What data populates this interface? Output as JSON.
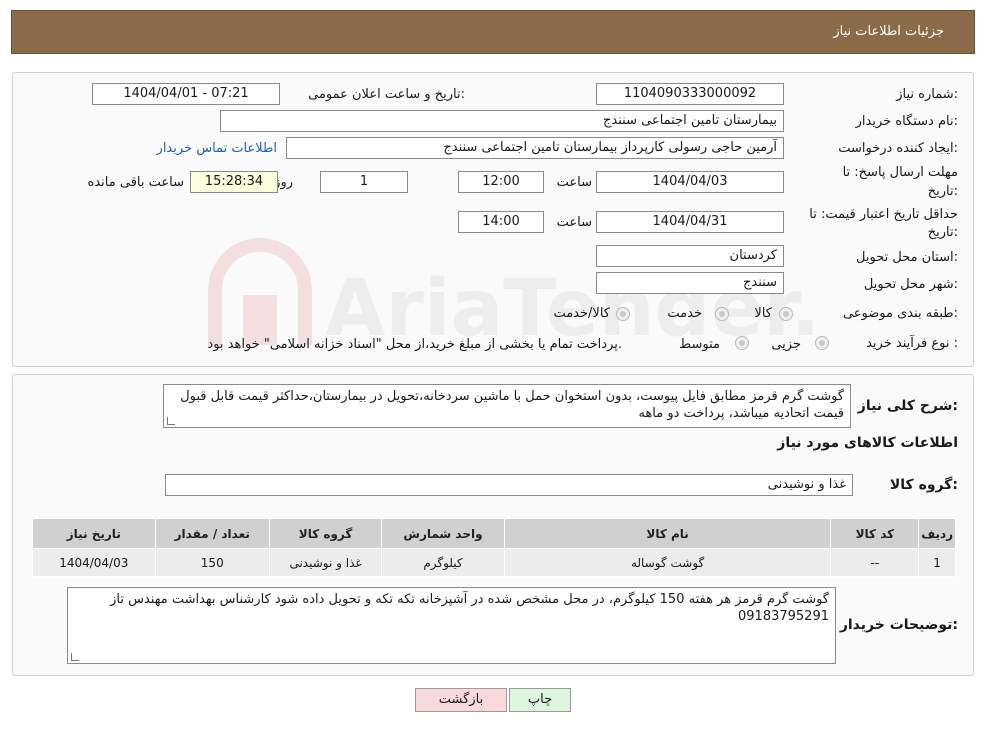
{
  "header": {
    "title": "جزئیات اطلاعات نیاز"
  },
  "form": {
    "need_number_label": "شماره نیاز:",
    "need_number": "1104090333000092",
    "announce_label": "تاریخ و ساعت اعلان عمومی:",
    "announce_value": "1404/04/01 - 07:21",
    "buyer_org_label": "نام دستگاه خریدار:",
    "buyer_org": "بیمارستان تامین اجتماعی سنندج",
    "requester_label": "ایجاد کننده درخواست:",
    "requester": "آرمین حاجی رسولی کارپرداز بیمارستان تامین اجتماعی سنندج",
    "contact_link": "اطلاعات تماس خریدار",
    "deadline_label_line1": "مهلت ارسال پاسخ: تا",
    "deadline_label_line2": "تاریخ:",
    "deadline_date": "1404/04/03",
    "time_label": "ساعت",
    "deadline_time": "12:00",
    "days_value": "1",
    "days_label": "روز و",
    "remaining_time": "15:28:34",
    "remaining_label": "ساعت باقی مانده",
    "validity_label_line1": "حداقل تاریخ اعتبار قیمت: تا",
    "validity_label_line2": "تاریخ:",
    "validity_date": "1404/04/31",
    "validity_time_label": "ساعت",
    "validity_time": "14:00",
    "province_label": "استان محل تحویل:",
    "province": "کردستان",
    "city_label": "شهر محل تحویل:",
    "city": "سنندج",
    "category_label": "طبقه بندی موضوعی:",
    "category_options": [
      "کالا",
      "خدمت",
      "کالا/خدمت"
    ],
    "process_label": "نوع فرآیند خرید :",
    "process_options": [
      "جزیی",
      "متوسط"
    ],
    "process_note": "پرداخت تمام یا بخشی از مبلغ خرید،از محل \"اسناد خزانه اسلامی\" خواهد بود."
  },
  "details": {
    "summary_label": "شرح کلی نیاز:",
    "summary_text": "گوشت گرم قرمز مطابق فایل پیوست، بدون استخوان حمل با ماشین سردخانه،تحویل در بیمارستان،حداکثر قیمت قابل قبول قیمت اتحادیه میباشد، پرداخت دو ماهه",
    "items_heading": "اطلاعات کالاهای مورد نیاز",
    "group_label": "گروه کالا:",
    "group_value": "غذا و نوشیدنی",
    "table": {
      "headers": [
        "ردیف",
        "کد کالا",
        "نام کالا",
        "واحد شمارش",
        "گروه کالا",
        "تعداد / مقدار",
        "تاریخ نیاز"
      ],
      "rows": [
        [
          "1",
          "--",
          "گوشت گوساله",
          "کیلوگرم",
          "غذا و نوشیدنی",
          "150",
          "1404/04/03"
        ]
      ]
    },
    "buyer_notes_label": "توضیحات خریدار:",
    "buyer_notes": "گوشت گرم قرمز هر هفته 150 کیلوگرم، در محل مشخص شده در آشپزخانه تکه تکه و تحویل داده شود کارشناس بهداشت مهندس تاز 09183795291"
  },
  "buttons": {
    "print": "چاپ",
    "back": "بازگشت"
  },
  "watermark": {
    "text": "AriaTender.neT"
  },
  "colors": {
    "header_bg": "#8b6a47",
    "link": "#1f5fbf",
    "back_button_bg": "#f9d9d9",
    "print_button_bg": "#dcf5dc"
  }
}
